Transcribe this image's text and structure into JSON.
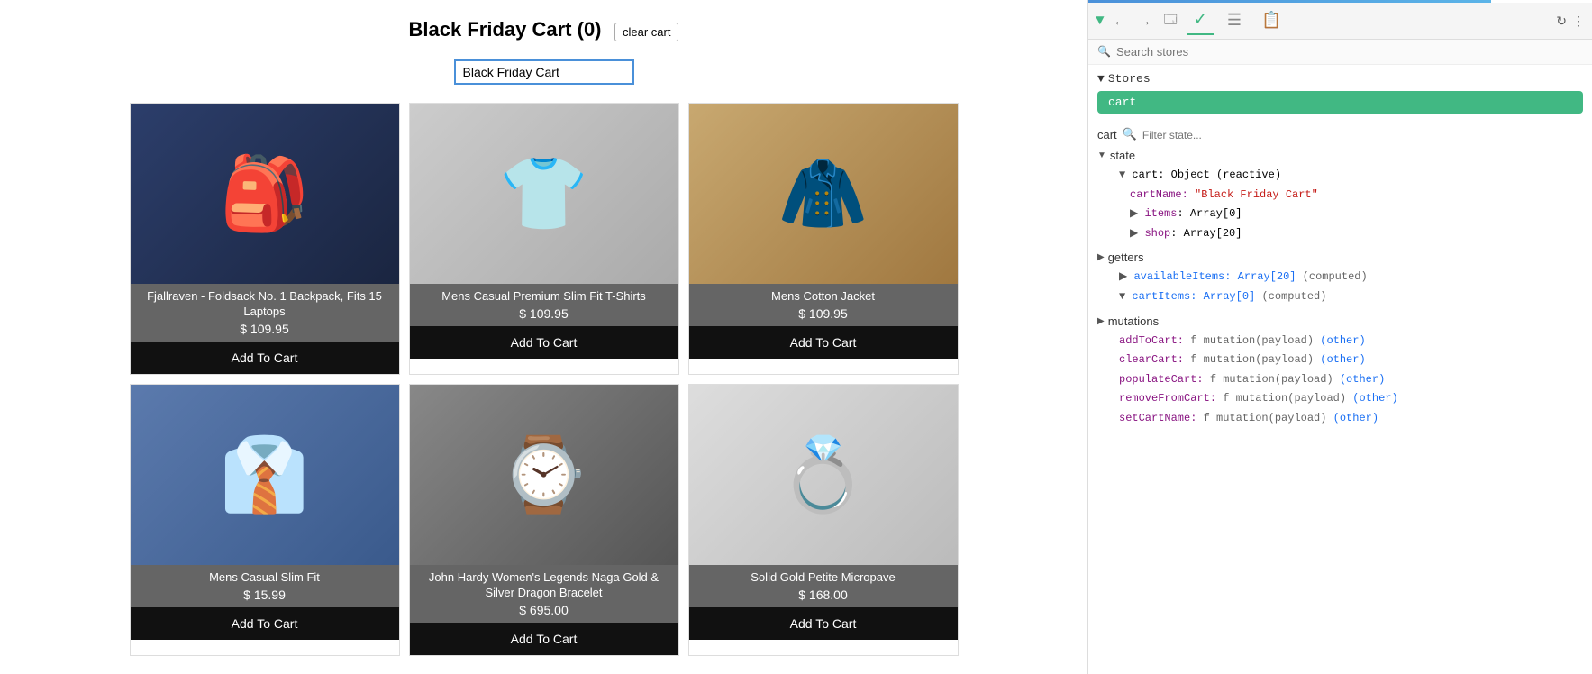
{
  "shop": {
    "title": "Black Friday Cart (0)",
    "clear_cart_label": "clear cart",
    "cart_name_value": "Black Friday Cart",
    "products": [
      {
        "id": 1,
        "name": "Fjallraven - Foldsack No. 1 Backpack, Fits 15 Laptops",
        "price": "$ 109.95",
        "add_label": "Add To Cart",
        "img_class": "img-backpack"
      },
      {
        "id": 2,
        "name": "Mens Casual Premium Slim Fit T-Shirts",
        "price": "$ 109.95",
        "add_label": "Add To Cart",
        "img_class": "img-tshirt"
      },
      {
        "id": 3,
        "name": "Mens Cotton Jacket",
        "price": "$ 109.95",
        "add_label": "Add To Cart",
        "img_class": "img-jacket"
      },
      {
        "id": 4,
        "name": "Mens Casual Slim Fit",
        "price": "$ 15.99",
        "add_label": "Add To Cart",
        "img_class": "img-sweater"
      },
      {
        "id": 5,
        "name": "John Hardy Women's Legends Naga Gold & Silver Dragon Bracelet",
        "price": "$ 695.00",
        "add_label": "Add To Cart",
        "img_class": "img-bracelet"
      },
      {
        "id": 6,
        "name": "Solid Gold Petite Micropave",
        "price": "$ 168.00",
        "add_label": "Add To Cart",
        "img_class": "img-ring"
      }
    ]
  },
  "devtools": {
    "vue_icon": "▼",
    "back_icon": "←",
    "forward_icon": "→",
    "search_stores_placeholder": "Search stores",
    "stores_label": "Stores",
    "store_items": [
      {
        "name": "cart",
        "active": true
      }
    ],
    "filter_placeholder": "Filter state...",
    "cart_label": "cart",
    "state_section": "state",
    "cart_object_label": "cart: Object (reactive)",
    "cart_name_label": "cartName:",
    "cart_name_value": "\"Black Friday Cart\"",
    "items_label": "items: Array[0]",
    "shop_label": "shop: Array[20]",
    "getters_section": "getters",
    "available_items_label": "availableItems: Array[20]",
    "available_items_suffix": "(computed)",
    "cart_items_label": "cartItems: Array[0]",
    "cart_items_suffix": "(computed)",
    "mutations_section": "mutations",
    "mutation_list": [
      {
        "name": "addToCart:",
        "signature": "f mutation(payload)",
        "tag": "(other)"
      },
      {
        "name": "clearCart:",
        "signature": "f mutation(payload)",
        "tag": "(other)"
      },
      {
        "name": "populateCart:",
        "signature": "f mutation(payload)",
        "tag": "(other)"
      },
      {
        "name": "removeFromCart:",
        "signature": "f mutation(payload)",
        "tag": "(other)"
      },
      {
        "name": "setCartName:",
        "signature": "f mutation(payload)",
        "tag": "(other)"
      }
    ]
  }
}
